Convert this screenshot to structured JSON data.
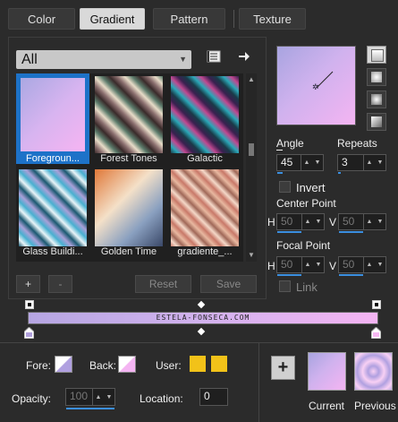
{
  "tabs": [
    {
      "label": "Color"
    },
    {
      "label": "Gradient"
    },
    {
      "label": "Pattern"
    },
    {
      "label": "Texture"
    }
  ],
  "library": {
    "filter": "All"
  },
  "gradients": [
    {
      "label": "Foregroun...",
      "selected": true
    },
    {
      "label": "Forest Tones"
    },
    {
      "label": "Galactic"
    },
    {
      "label": "Glass Buildi..."
    },
    {
      "label": "Golden Time"
    },
    {
      "label": "gradiente_..."
    }
  ],
  "buttons": {
    "add": "+",
    "remove": "-",
    "reset": "Reset",
    "save": "Save"
  },
  "settings": {
    "angle_label": "Angle",
    "angle": "45",
    "repeats_label": "Repeats",
    "repeats": "3",
    "invert_label": "Invert",
    "center_label": "Center Point",
    "center_h": "50",
    "center_v": "50",
    "focal_label": "Focal Point",
    "focal_h": "50",
    "focal_v": "50",
    "link_label": "Link",
    "h": "H",
    "v": "V"
  },
  "gradient_bar": {
    "text": "ESTELA-FONSECA.COM"
  },
  "bottom": {
    "fore_label": "Fore:",
    "back_label": "Back:",
    "user_label": "User:",
    "opacity_label": "Opacity:",
    "opacity": "100",
    "location_label": "Location:",
    "location": "0",
    "current_label": "Current",
    "previous_label": "Previous"
  },
  "colors": {
    "lavender": "#b8a8e0",
    "pink": "#f4b6f0",
    "user_swatch": "#f2c219",
    "accent": "#1d72c8"
  }
}
